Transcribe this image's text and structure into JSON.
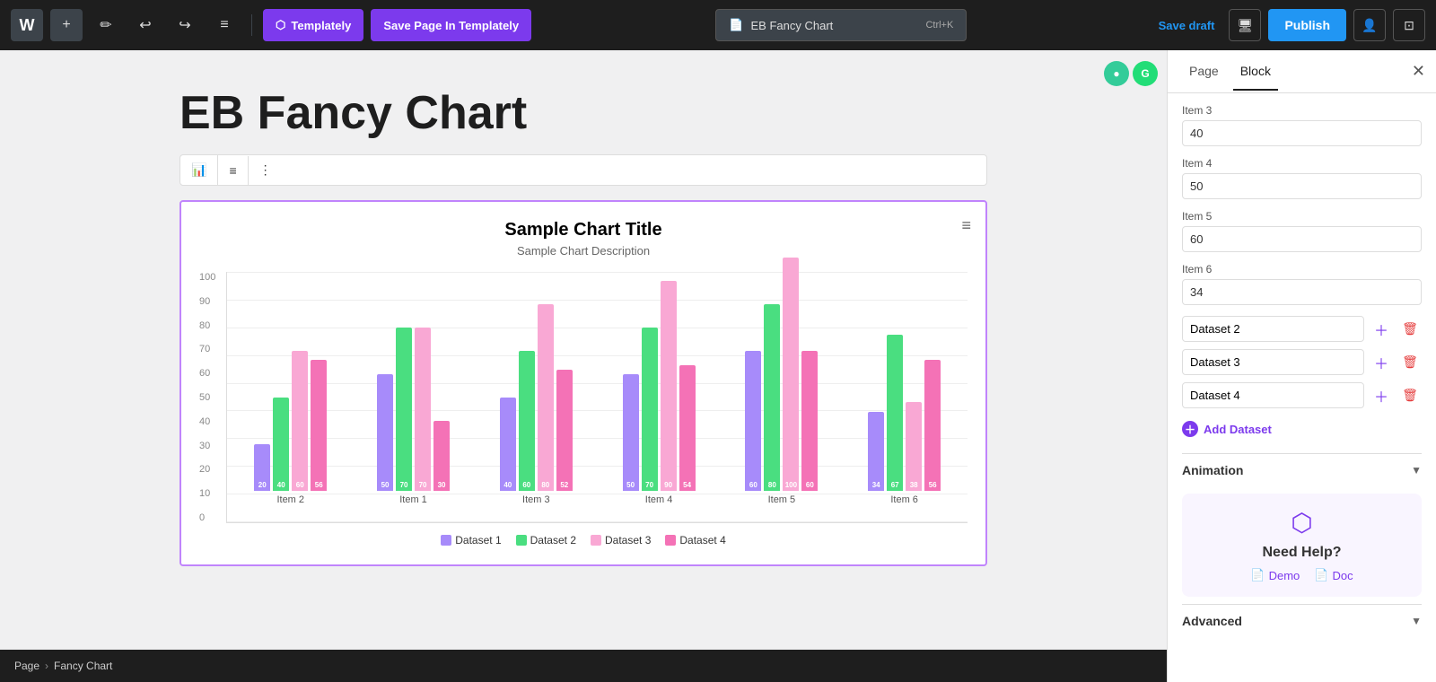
{
  "toolbar": {
    "wp_logo": "W",
    "plus_label": "+",
    "pencil_label": "✏",
    "undo_label": "↩",
    "redo_label": "↪",
    "list_label": "≡",
    "templately_label": "Templately",
    "save_page_label": "Save Page In Templately",
    "search_text": "EB Fancy Chart",
    "search_shortcut": "Ctrl+K",
    "save_draft_label": "Save draft",
    "publish_label": "Publish",
    "user_icon": "👤",
    "sidebar_icon": "⊡"
  },
  "page": {
    "title": "EB Fancy Chart"
  },
  "chart": {
    "title": "Sample Chart Title",
    "description": "Sample Chart Description",
    "y_axis": [
      "0",
      "10",
      "20",
      "30",
      "40",
      "50",
      "60",
      "70",
      "80",
      "90",
      "100"
    ],
    "groups": [
      {
        "label": "Item 2",
        "bars": [
          {
            "value": 20,
            "label": "20",
            "color": "#a78bfa"
          },
          {
            "value": 40,
            "label": "40",
            "color": "#4ade80"
          },
          {
            "value": 60,
            "label": "60",
            "color": "#f9a8d4"
          },
          {
            "value": 56,
            "label": "56",
            "color": "#f472b6"
          }
        ]
      },
      {
        "label": "Item 1",
        "bars": [
          {
            "value": 50,
            "label": "50",
            "color": "#a78bfa"
          },
          {
            "value": 70,
            "label": "70",
            "color": "#4ade80"
          },
          {
            "value": 70,
            "label": "70",
            "color": "#f9a8d4"
          },
          {
            "value": 30,
            "label": "30",
            "color": "#f472b6"
          }
        ]
      },
      {
        "label": "Item 3",
        "bars": [
          {
            "value": 40,
            "label": "40",
            "color": "#a78bfa"
          },
          {
            "value": 60,
            "label": "60",
            "color": "#4ade80"
          },
          {
            "value": 80,
            "label": "80",
            "color": "#f9a8d4"
          },
          {
            "value": 52,
            "label": "52",
            "color": "#f472b6"
          }
        ]
      },
      {
        "label": "Item 4",
        "bars": [
          {
            "value": 50,
            "label": "50",
            "color": "#a78bfa"
          },
          {
            "value": 70,
            "label": "70",
            "color": "#4ade80"
          },
          {
            "value": 90,
            "label": "90",
            "color": "#f9a8d4"
          },
          {
            "value": 54,
            "label": "54",
            "color": "#f472b6"
          }
        ]
      },
      {
        "label": "Item 5",
        "bars": [
          {
            "value": 60,
            "label": "60",
            "color": "#a78bfa"
          },
          {
            "value": 80,
            "label": "80",
            "color": "#4ade80"
          },
          {
            "value": 100,
            "label": "100",
            "color": "#f9a8d4"
          },
          {
            "value": 60,
            "label": "60",
            "color": "#f472b6"
          }
        ]
      },
      {
        "label": "Item 6",
        "bars": [
          {
            "value": 34,
            "label": "34",
            "color": "#a78bfa"
          },
          {
            "value": 67,
            "label": "67",
            "color": "#4ade80"
          },
          {
            "value": 38,
            "label": "38",
            "color": "#f9a8d4"
          },
          {
            "value": 56,
            "label": "56",
            "color": "#f472b6"
          }
        ]
      }
    ],
    "legend": [
      {
        "label": "Dataset 1",
        "color": "#a78bfa"
      },
      {
        "label": "Dataset 2",
        "color": "#4ade80"
      },
      {
        "label": "Dataset 3",
        "color": "#f9a8d4"
      },
      {
        "label": "Dataset 4",
        "color": "#f472b6"
      }
    ]
  },
  "sidebar": {
    "tab_page": "Page",
    "tab_block": "Block",
    "fields": [
      {
        "label": "Item 3",
        "value": "40"
      },
      {
        "label": "Item 4",
        "value": "50"
      },
      {
        "label": "Item 5",
        "value": "60"
      },
      {
        "label": "Item 6",
        "value": "34"
      }
    ],
    "datasets": [
      {
        "label": "Dataset 2"
      },
      {
        "label": "Dataset 3"
      },
      {
        "label": "Dataset 4"
      }
    ],
    "add_dataset_label": "Add Dataset",
    "animation_label": "Animation",
    "advanced_label": "Advanced",
    "help_title": "Need Help?",
    "demo_label": "Demo",
    "doc_label": "Doc"
  },
  "breadcrumb": {
    "page_label": "Page",
    "separator": "›",
    "current": "Fancy Chart"
  },
  "block_toolbar": {
    "chart_icon": "📊",
    "align_icon": "≡",
    "more_icon": "⋮"
  }
}
